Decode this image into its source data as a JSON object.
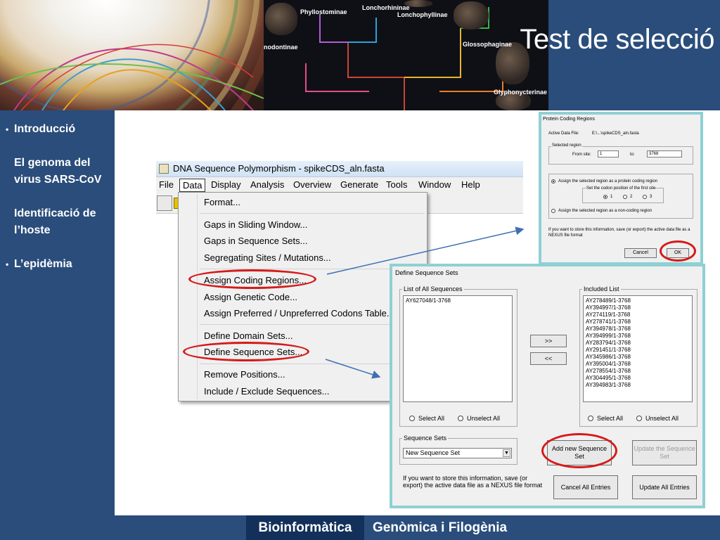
{
  "slide": {
    "title": "Test de selecció",
    "header_clades": [
      "Phyllostominae",
      "Lonchorhininae",
      "Lonchophyllinae",
      "nodontinae",
      "Glossophaginae",
      "Glyphonycterinae"
    ],
    "bullets": [
      "Introducció",
      "El genoma del virus SARS-CoV",
      "Identificació de l’hoste",
      "L’epidèmia"
    ],
    "footer_left": "Bioinformàtica",
    "footer_right": "Genòmica i Filogènia"
  },
  "app": {
    "title": "DNA Sequence Polymorphism - spikeCDS_aln.fasta",
    "menu": [
      "File",
      "Data",
      "Display",
      "Analysis",
      "Overview",
      "Generate",
      "Tools",
      "Window",
      "Help"
    ],
    "active_menu": "Data"
  },
  "dropdown": {
    "items": [
      "Format...",
      "Gaps in Sliding Window...",
      "Gaps in Sequence Sets...",
      "Segregating Sites / Mutations...",
      "Assign Coding Regions...",
      "Assign Genetic Code...",
      "Assign Preferred / Unpreferred Codons Table...",
      "Define Domain Sets...",
      "Define Sequence Sets...",
      "Remove Positions...",
      "Include / Exclude Sequences..."
    ]
  },
  "pcr_dialog": {
    "title": "Protein Coding Regions",
    "active_file_label": "Active Data File:",
    "active_file": "E:\\...\\spikeCDS_aln.fasta",
    "selected_region_label": "Selected region",
    "from_label": "From site:",
    "from_value": "1",
    "to_label": "to:",
    "to_value": "3768",
    "opt_coding": "Assign the selected region as a protein coding region",
    "codon_label": "Set the codon position of the first site",
    "codon_options": [
      "1",
      "2",
      "3"
    ],
    "opt_noncoding": "Assign the selected region as a non-coding region",
    "note": "If you want to store this information, save (or export) the active data file as a NEXUS file format",
    "cancel": "Cancel",
    "ok": "OK"
  },
  "dss_dialog": {
    "title": "Define Sequence Sets",
    "all_label": "List of All Sequences",
    "all_sequences": [
      "AY627048/1-3768"
    ],
    "included_label": "Included List",
    "included_sequences": [
      "AY278489/1-3768",
      "AY394997/1-3768",
      "AY274119/1-3768",
      "AY278741/1-3768",
      "AY394978/1-3768",
      "AY394999/1-3768",
      "AY283794/1-3768",
      "AY291451/1-3768",
      "AY345986/1-3768",
      "AY395004/1-3768",
      "AY278554/1-3768",
      "AY304495/1-3768",
      "AY394983/1-3768"
    ],
    "move_right": ">>",
    "move_left": "<<",
    "select_all": "Select All",
    "unselect_all": "Unselect All",
    "sets_label": "Sequence Sets",
    "set_value": "New Sequence Set",
    "add_new": "Add new Sequence Set",
    "update_set": "Update the Sequence Set",
    "note": "If you want to store this information, save (or export) the active data file as a NEXUS file format",
    "cancel_all": "Cancel All Entries",
    "update_all": "Update All Entries"
  }
}
